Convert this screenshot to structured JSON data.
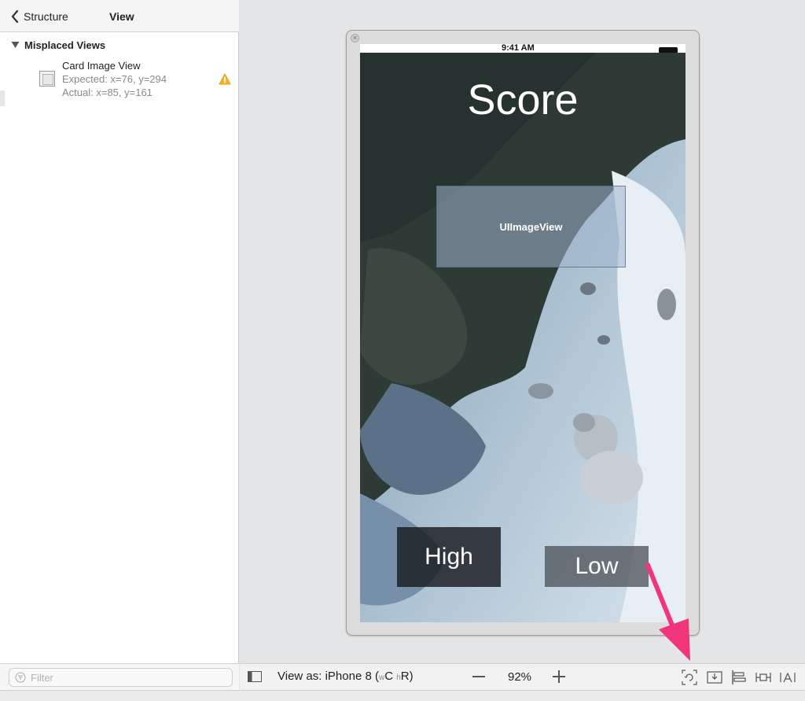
{
  "navigator": {
    "back_label": "Structure",
    "title": "View",
    "section_title": "Misplaced Views",
    "issue": {
      "title": "Card Image View",
      "expected": "Expected: x=76, y=294",
      "actual": "Actual: x=85, y=161",
      "icon": "warning-triangle-icon"
    },
    "filter_placeholder": "Filter"
  },
  "device": {
    "status_time": "9:41 AM",
    "score_label": "Score",
    "image_view_label": "UIImageView",
    "high_button": "High",
    "low_button": "Low"
  },
  "toolbar": {
    "view_as_prefix": "View as: iPhone 8",
    "size_class_w": "w",
    "size_class_c": "C",
    "size_class_h": "h",
    "size_class_r": "R",
    "zoom": "92%",
    "icons": [
      "toggle-panel-icon",
      "update-frames-icon",
      "embed-in-icon",
      "align-icon",
      "add-constraints-icon",
      "resolve-issues-icon"
    ]
  },
  "colors": {
    "warning": "#f0b429",
    "arrow": "#f0357a",
    "panel_bg": "#ffffff",
    "canvas_bg": "#e4e5e7"
  }
}
